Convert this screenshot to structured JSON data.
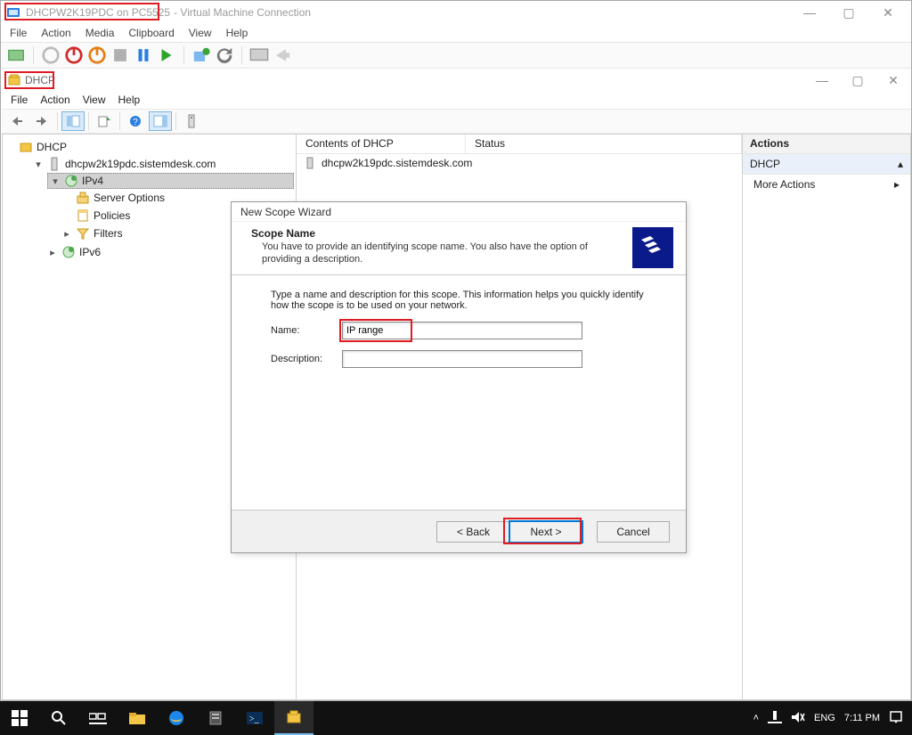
{
  "vm": {
    "title_left": "DHCPW2K19PDC on PC5525",
    "title_right": "- Virtual Machine Connection",
    "menu": [
      "File",
      "Action",
      "Media",
      "Clipboard",
      "View",
      "Help"
    ],
    "winctrl": {
      "min": "—",
      "max": "▢",
      "close": "✕"
    }
  },
  "mmc": {
    "title": "DHCP",
    "menu": [
      "File",
      "Action",
      "View",
      "Help"
    ],
    "winctrl": {
      "min": "—",
      "max": "▢",
      "close": "✕"
    },
    "tree": {
      "root": "DHCP",
      "server": "dhcpw2k19pdc.sistemdesk.com",
      "ipv4": "IPv4",
      "ipv4_children": [
        "Server Options",
        "Policies",
        "Filters"
      ],
      "ipv6": "IPv6"
    },
    "list": {
      "col_contents": "Contents of DHCP",
      "col_status": "Status",
      "row0": "dhcpw2k19pdc.sistemdesk.com"
    },
    "actions": {
      "title": "Actions",
      "context": "DHCP",
      "more": "More Actions",
      "arrow_up": "▴",
      "arrow_right": "▸"
    }
  },
  "wizard": {
    "title": "New Scope Wizard",
    "header_title": "Scope Name",
    "header_text": "You have to provide an identifying scope name. You also have the option of providing a description.",
    "body_text": "Type a name and description for this scope. This information helps you quickly identify how the scope is to be used on your network.",
    "name_label": "Name:",
    "name_value": "IP range",
    "desc_label": "Description:",
    "desc_value": "",
    "btn_back": "< Back",
    "btn_next": "Next >",
    "btn_cancel": "Cancel"
  },
  "taskbar": {
    "lang": "ENG",
    "time": "7:11 PM"
  },
  "glyphs": {
    "chevron_up": "˄"
  }
}
